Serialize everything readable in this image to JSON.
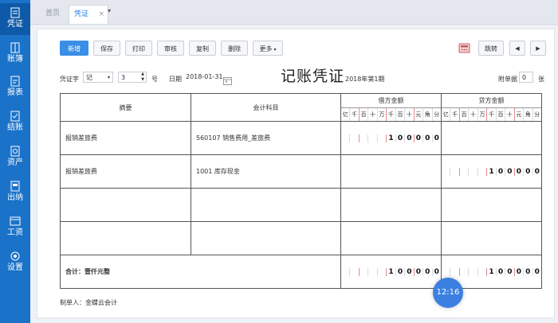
{
  "sidebar": {
    "items": [
      {
        "label": "凭证",
        "icon": "voucher-icon"
      },
      {
        "label": "账簿",
        "icon": "ledger-icon"
      },
      {
        "label": "报表",
        "icon": "report-icon"
      },
      {
        "label": "结账",
        "icon": "close-account-icon"
      },
      {
        "label": "资产",
        "icon": "asset-icon"
      },
      {
        "label": "出纳",
        "icon": "cashier-icon"
      },
      {
        "label": "工资",
        "icon": "payroll-icon"
      },
      {
        "label": "设置",
        "icon": "settings-icon"
      }
    ]
  },
  "tabs": {
    "home": "首页",
    "voucher": "凭证",
    "close": "×",
    "more": "▾"
  },
  "toolbar": {
    "new": "新增",
    "save": "保存",
    "print": "打印",
    "audit": "审核",
    "copy": "复制",
    "delete": "删除",
    "more": "更多",
    "more_arrow": "▾",
    "jump": "跳转",
    "prev": "◀",
    "next": "▶"
  },
  "voucher": {
    "word_label": "凭证字",
    "word_value": "记",
    "number_value": "3",
    "number_suffix": "号",
    "date_label": "日期",
    "date_value": "2018-01-31",
    "title": "记账凭证",
    "period": "2018年第1期",
    "attachments_label": "附单据",
    "attachments_value": "0",
    "attachments_suffix": "张"
  },
  "table": {
    "col_summary": "摘要",
    "col_account": "会计科目",
    "col_debit": "借方金额",
    "col_credit": "贷方金额",
    "digit_units": [
      "亿",
      "千",
      "百",
      "十",
      "万",
      "千",
      "百",
      "十",
      "元",
      "角",
      "分"
    ],
    "rows": [
      {
        "summary": "报销差旅费",
        "account": "560107 销售费用_差旅费",
        "debit": [
          "",
          "",
          "",
          "",
          "",
          "1",
          "0",
          "0",
          "0",
          "0",
          "0"
        ],
        "credit": [
          "",
          "",
          "",
          "",
          "",
          "",
          "",
          "",
          "",
          "",
          ""
        ]
      },
      {
        "summary": "报销差旅费",
        "account": "1001 库存现金",
        "debit": [
          "",
          "",
          "",
          "",
          "",
          "",
          "",
          "",
          "",
          "",
          ""
        ],
        "credit": [
          "",
          "",
          "",
          "",
          "",
          "1",
          "0",
          "0",
          "0",
          "0",
          "0"
        ]
      },
      {
        "summary": "",
        "account": "",
        "debit": [
          "",
          "",
          "",
          "",
          "",
          "",
          "",
          "",
          "",
          "",
          ""
        ],
        "credit": [
          "",
          "",
          "",
          "",
          "",
          "",
          "",
          "",
          "",
          "",
          ""
        ]
      },
      {
        "summary": "",
        "account": "",
        "debit": [
          "",
          "",
          "",
          "",
          "",
          "",
          "",
          "",
          "",
          "",
          ""
        ],
        "credit": [
          "",
          "",
          "",
          "",
          "",
          "",
          "",
          "",
          "",
          "",
          ""
        ]
      }
    ],
    "total_label": "合计：壹仟元整",
    "total_debit": [
      "",
      "",
      "",
      "",
      "",
      "1",
      "0",
      "0",
      "0",
      "0",
      "0"
    ],
    "total_credit": [
      "",
      "",
      "",
      "",
      "",
      "1",
      "0",
      "0",
      "0",
      "0",
      "0"
    ]
  },
  "footer": {
    "preparer": "制单人：金蝶云会计"
  },
  "overlay": {
    "timer": "12:16"
  }
}
